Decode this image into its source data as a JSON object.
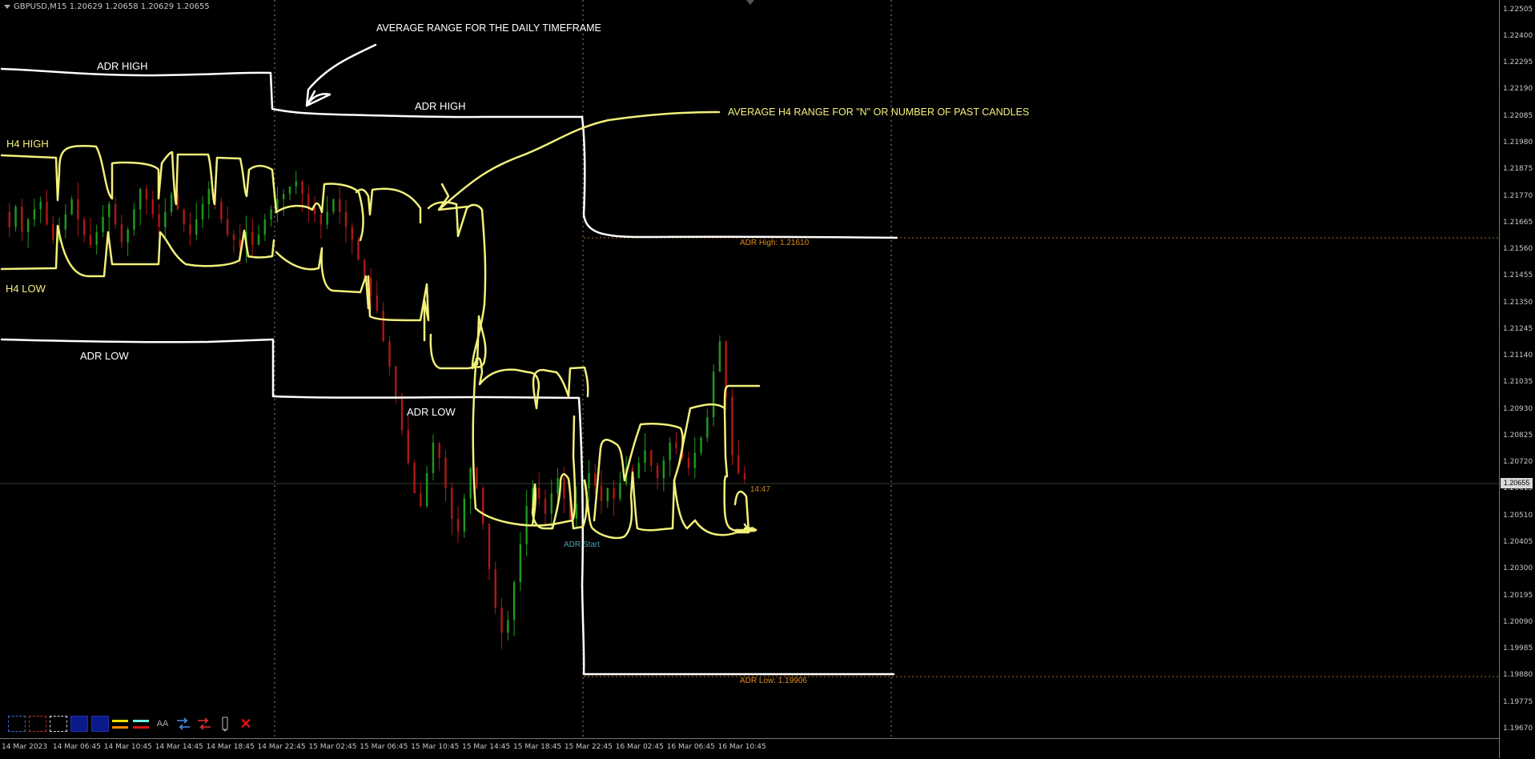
{
  "header": {
    "symbol_info": "GBPUSD,M15  1.20629 1.20658 1.20629 1.20655"
  },
  "annotations": {
    "top_title": "AVERAGE RANGE FOR THE DAILY TIMEFRAME",
    "h4_note": "AVERAGE H4 RANGE FOR \"N\" OR NUMBER OF PAST CANDLES",
    "adr_high_1": "ADR HIGH",
    "adr_high_2": "ADR HIGH",
    "adr_low_1": "ADR LOW",
    "adr_low_2": "ADR LOW",
    "h4_high": "H4 HIGH",
    "h4_low": "H4 LOW"
  },
  "indicator_labels": {
    "adr_high": "ADR High: 1.21610",
    "adr_low": "ADR Low: 1.19906",
    "adr_start": "ADR Start",
    "countdown": "14:47",
    "current_price": "1.20655"
  },
  "colors": {
    "background": "#000000",
    "bull_candle": "#1f9a1f",
    "bear_candle": "#b01818",
    "handdrawn_yellow": "#f2f07a",
    "handdrawn_white": "#ffffff",
    "adr_label_orange": "#e08a1a",
    "adr_start_teal": "#4aa0b4",
    "current_price_line": "#2f3f2f"
  },
  "toolbar": {
    "items": [
      "dashed-blue-rect-icon",
      "dashed-red-rect-icon",
      "dashed-white-rect-icon",
      "solid-blue-rect-icon",
      "solid-blue-rect-icon",
      "yellow-orange-lines-icon",
      "cyan-red-lines-icon",
      "text-size-icon",
      "blue-arrows-icon",
      "red-arrows-icon",
      "pencil-icon",
      "close-icon"
    ],
    "text_size_label": "AA"
  },
  "chart_data": {
    "type": "candlestick",
    "symbol": "GBPUSD",
    "timeframe": "M15",
    "y_ticks": [
      "1.22505",
      "1.22400",
      "1.22295",
      "1.22190",
      "1.22085",
      "1.21980",
      "1.21875",
      "1.21770",
      "1.21665",
      "1.21560",
      "1.21455",
      "1.21350",
      "1.21245",
      "1.21140",
      "1.21035",
      "1.20930",
      "1.20825",
      "1.20720",
      "1.20615",
      "1.20510",
      "1.20405",
      "1.20300",
      "1.20195",
      "1.20090",
      "1.19985",
      "1.19880",
      "1.19775",
      "1.19670"
    ],
    "x_ticks": [
      "14 Mar 2023",
      "14 Mar 06:45",
      "14 Mar 10:45",
      "14 Mar 14:45",
      "14 Mar 18:45",
      "14 Mar 22:45",
      "15 Mar 02:45",
      "15 Mar 06:45",
      "15 Mar 10:45",
      "15 Mar 14:45",
      "15 Mar 18:45",
      "15 Mar 22:45",
      "16 Mar 02:45",
      "16 Mar 06:45",
      "16 Mar 10:45"
    ],
    "ylim": [
      1.19635,
      1.22545
    ],
    "current_price": 1.20655,
    "adr_high": 1.2161,
    "adr_low": 1.19906,
    "price_path": [
      [
        1.2171,
        1.2165,
        1.2173,
        1.2163,
        1.2168,
        1.2172,
        1.2175,
        1.2166,
        1.216,
        1.2164,
        1.217,
        1.2176,
        1.2168,
        1.2162,
        1.2158,
        1.2163,
        1.2169,
        1.2174,
        1.2166,
        1.2159
      ],
      [
        1.2164,
        1.2172,
        1.218,
        1.2176,
        1.217,
        1.2165,
        1.2171,
        1.2178,
        1.2172,
        1.2166,
        1.2162,
        1.2168,
        1.2174,
        1.218,
        1.2175,
        1.2168,
        1.2162,
        1.216,
        1.2157,
        1.2163
      ],
      [
        1.2158,
        1.2162,
        1.2168,
        1.2172,
        1.2176,
        1.2178,
        1.2181,
        1.2183,
        1.2178,
        1.2173,
        1.217,
        1.2166,
        1.2171,
        1.2176,
        1.2171,
        1.2165,
        1.216,
        1.2152,
        1.2145,
        1.2138
      ],
      [
        1.2132,
        1.212,
        1.211,
        1.2098,
        1.2085,
        1.2072,
        1.206,
        1.2055,
        1.2068,
        1.208,
        1.2074,
        1.2062,
        1.205,
        1.2045,
        1.2058,
        1.207,
        1.2062,
        1.2048,
        1.203,
        1.2015
      ],
      [
        1.2005,
        1.201,
        1.2025,
        1.204,
        1.2055,
        1.2062,
        1.2058,
        1.2052,
        1.206,
        1.2066,
        1.2058,
        1.205,
        1.2056,
        1.2062,
        1.2068,
        1.2063,
        1.2057,
        1.2062
      ],
      [
        1.2058,
        1.2064,
        1.207,
        1.2066,
        1.2072,
        1.2077,
        1.2071,
        1.2066,
        1.2073,
        1.208,
        1.2078,
        1.2074,
        1.207,
        1.2076,
        1.2082,
        1.209,
        1.2108,
        1.212,
        1.2098,
        1.2075,
        1.2068,
        1.20655
      ]
    ]
  }
}
